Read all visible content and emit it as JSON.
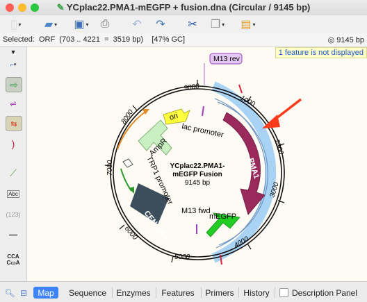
{
  "window": {
    "title": "YCplac22.PMA1-mEGFP + fusion.dna  (Circular / 9145 bp)"
  },
  "toolbar": {
    "icons": [
      "new-document-icon",
      "open-folder-icon",
      "save-icon",
      "print-icon",
      "undo-icon",
      "redo-icon",
      "cut-icon",
      "copy-icon",
      "paste-icon"
    ]
  },
  "status": {
    "selection": "Selected:  ORF  (703 .. 4221  =  3519 bp)    [47% GC]",
    "length": "9145 bp"
  },
  "notice": "1 feature is not displayed",
  "map": {
    "center_title": "YCplac22.PMA1-",
    "center_title2": "mEGFP Fusion",
    "center_length": "9145 bp",
    "ticks": [
      "9000",
      "1000",
      "2000",
      "3000",
      "4000",
      "5000",
      "6000",
      "7000",
      "8000"
    ],
    "features": {
      "m13rev": "M13 rev",
      "ori": "ori",
      "lac": "lac promoter",
      "ampr": "AmpR",
      "trp1": "TRP1 promoter",
      "cen": "CEN/ARS",
      "pma1": "PMA1",
      "m13fwd": "M13 fwd",
      "megfp": "mEGFP"
    }
  },
  "tabs": [
    "Map",
    "Sequence",
    "Enzymes",
    "Features",
    "Primers",
    "History",
    "Description Panel"
  ],
  "active_tab": "Map"
}
